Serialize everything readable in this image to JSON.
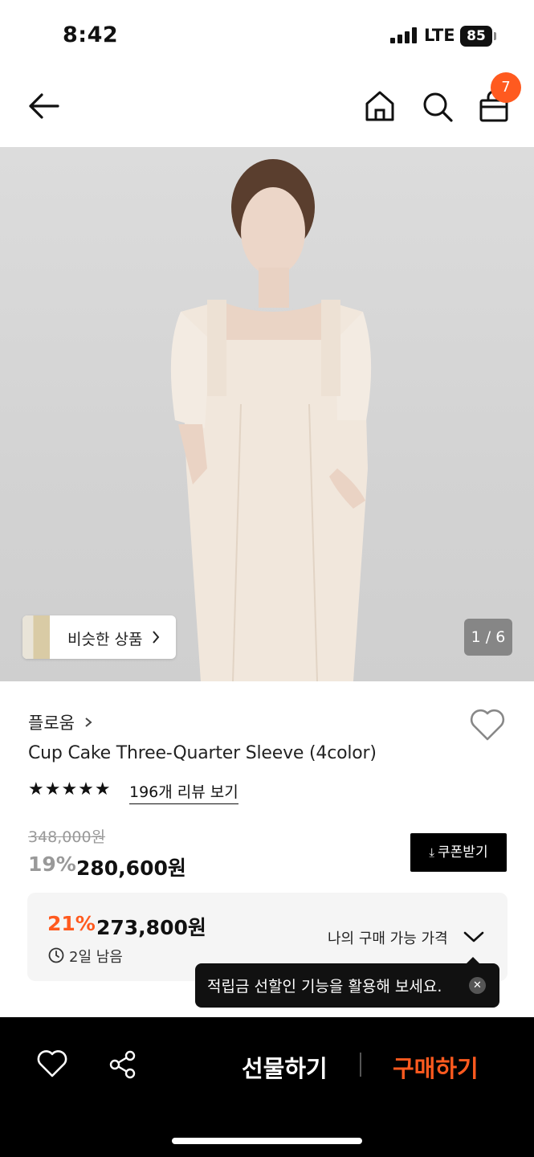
{
  "status_bar": {
    "time": "8:42",
    "network": "LTE",
    "battery": "85"
  },
  "nav": {
    "cart_count": "7"
  },
  "gallery": {
    "similar_label": "비슷한 상품",
    "counter": "1 / 6"
  },
  "product": {
    "brand": "플로움",
    "title": "Cup Cake Three-Quarter Sleeve (4color)",
    "rating_stars": "★★★★★",
    "review_link": "196개 리뷰 보기",
    "original_price": "348,000원",
    "discount": "19%",
    "price": "280,600원",
    "coupon_button": "쿠폰받기"
  },
  "my_price": {
    "discount": "21%",
    "price": "273,800원",
    "remaining": "2일 남음",
    "label": "나의 구매 가능 가격"
  },
  "tooltip": {
    "text": "적립금 선할인 기능을 활용해 보세요."
  },
  "bottom_bar": {
    "gift_label": "선물하기",
    "buy_label": "구매하기"
  },
  "colors": {
    "accent": "#ff5a1f",
    "dark": "#000000",
    "panel": "#f5f5f5"
  },
  "icons": [
    "back-arrow-icon",
    "home-icon",
    "search-icon",
    "shopping-bag-icon",
    "heart-icon",
    "share-icon",
    "clock-icon",
    "chevron-down-icon",
    "close-icon"
  ]
}
